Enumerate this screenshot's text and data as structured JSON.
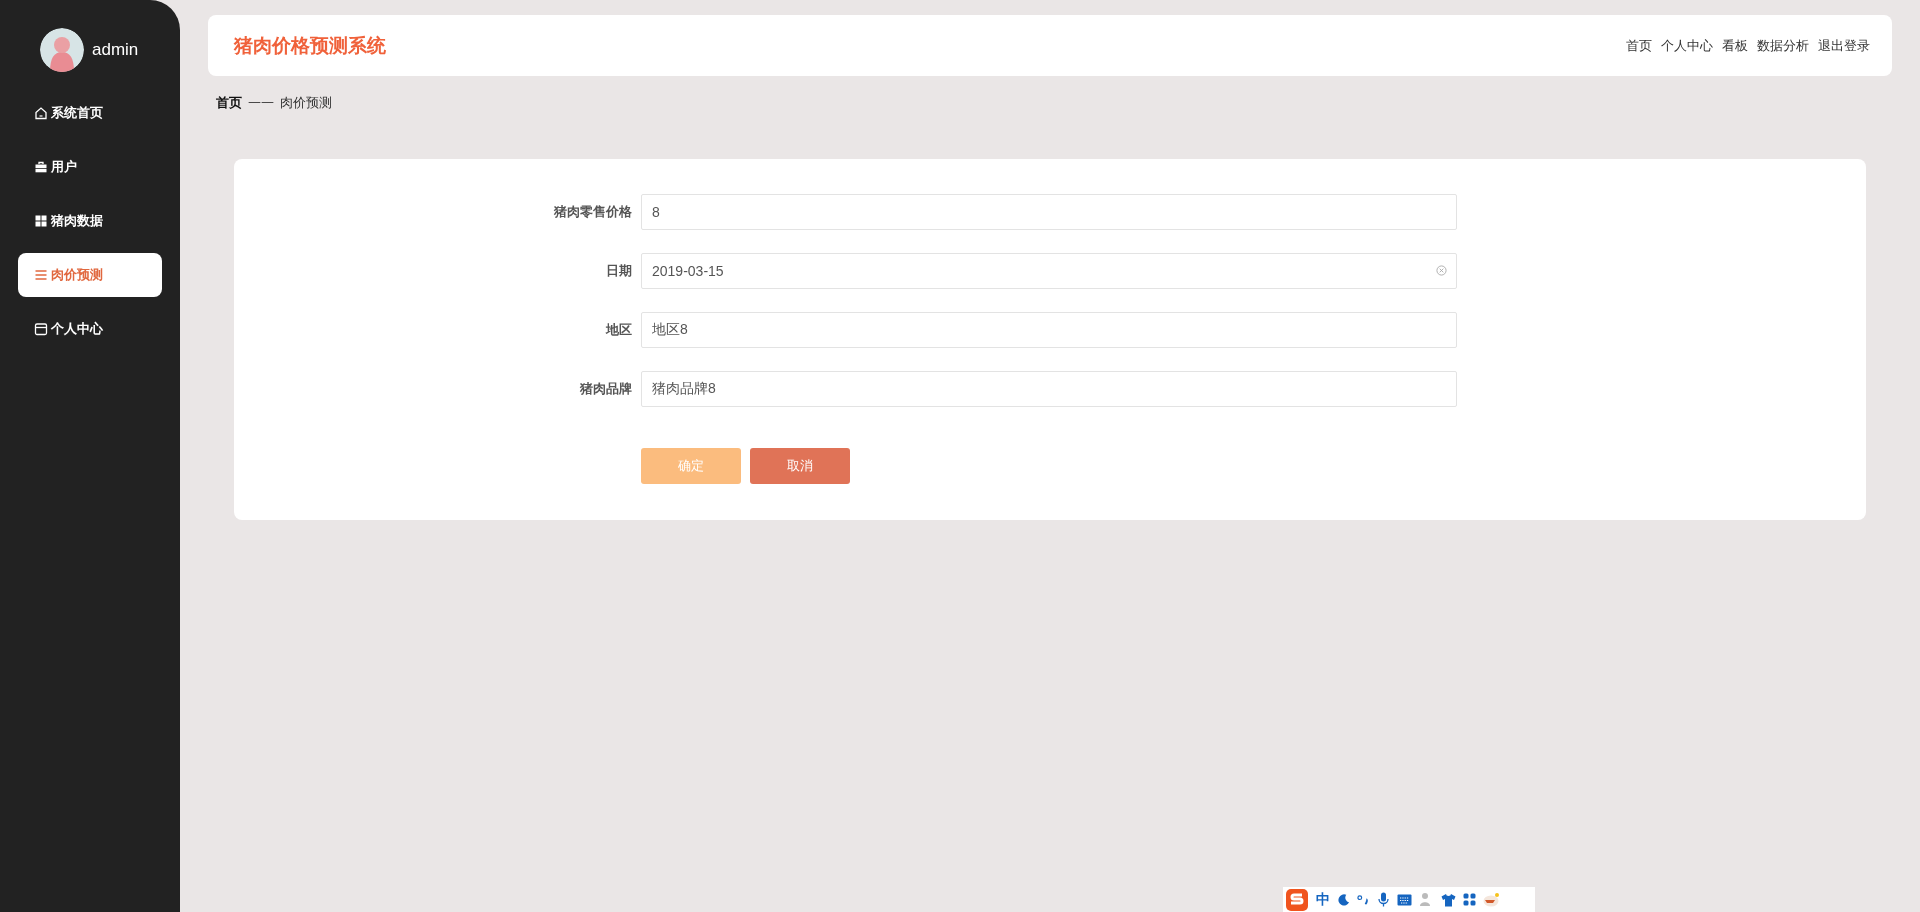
{
  "sidebar": {
    "user": {
      "name": "admin"
    },
    "items": [
      {
        "label": "系统首页",
        "kind": "home",
        "selected": false
      },
      {
        "label": "用户",
        "kind": "briefcase",
        "selected": false
      },
      {
        "label": "猪肉数据",
        "kind": "grid",
        "selected": false
      },
      {
        "label": "肉价预测",
        "kind": "list",
        "selected": true
      },
      {
        "label": "个人中心",
        "kind": "card",
        "selected": false
      }
    ]
  },
  "header": {
    "title": "猪肉价格预测系统",
    "nav": [
      "首页",
      "个人中心",
      "看板",
      "数据分析",
      "退出登录"
    ]
  },
  "breadcrumb": {
    "home": "首页",
    "separator": "——",
    "current": "肉价预测"
  },
  "form": {
    "fields": [
      {
        "label": "猪肉零售价格",
        "value": "8",
        "kind": "text"
      },
      {
        "label": "日期",
        "value": "2019-03-15",
        "kind": "date"
      },
      {
        "label": "地区",
        "value": "地区8",
        "kind": "text"
      },
      {
        "label": "猪肉品牌",
        "value": "猪肉品牌8",
        "kind": "text"
      }
    ],
    "buttons": [
      {
        "label": "确定",
        "kind": "primary"
      },
      {
        "label": "取消",
        "kind": "cancel"
      }
    ]
  },
  "ime_bar": {
    "mode": "中"
  }
}
